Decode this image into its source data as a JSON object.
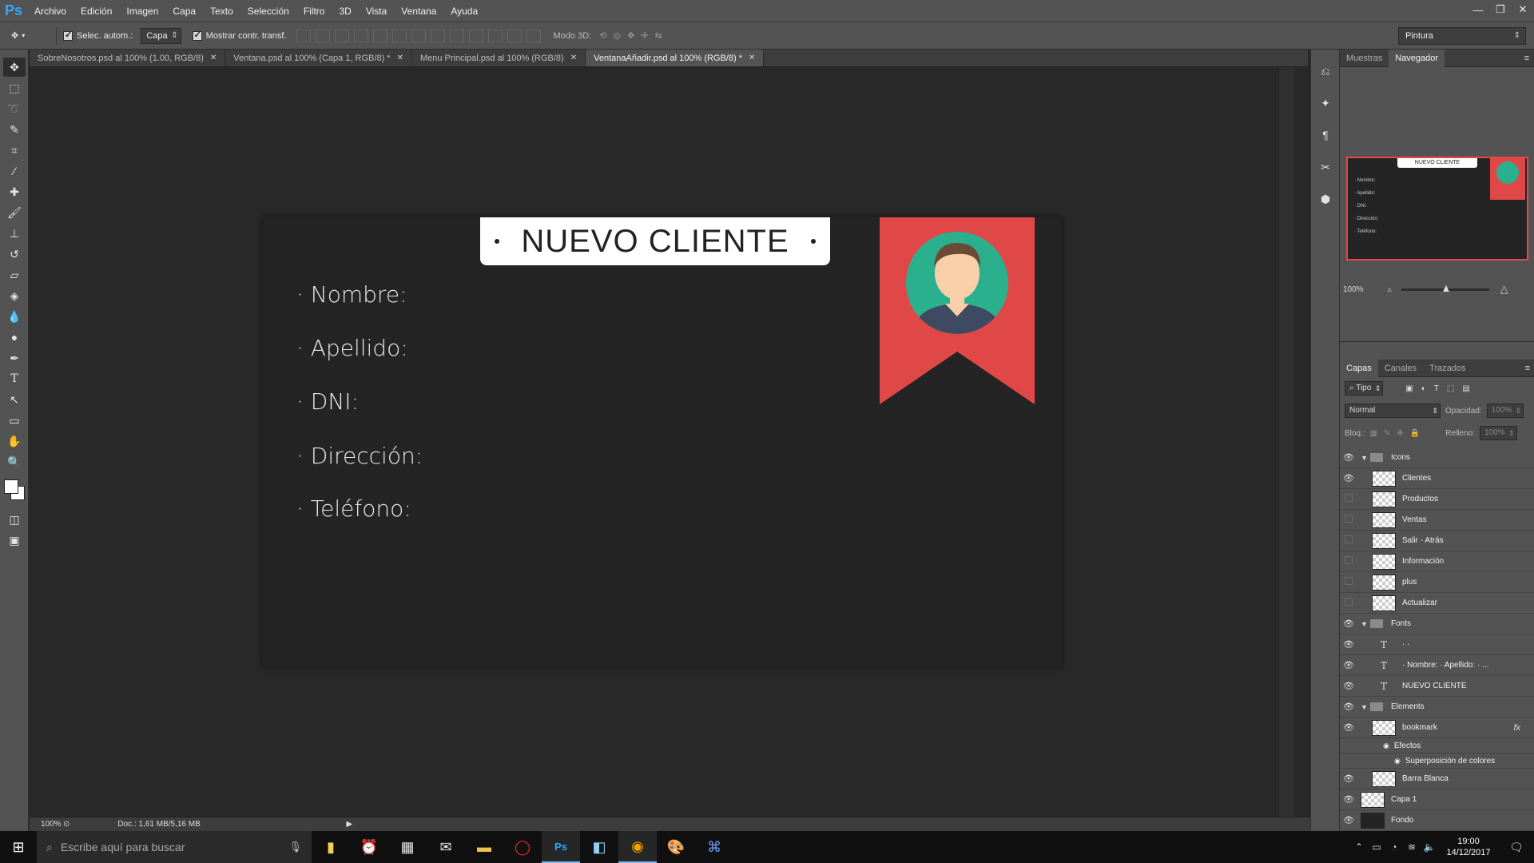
{
  "app": {
    "logo": "Ps",
    "menu": [
      "Archivo",
      "Edición",
      "Imagen",
      "Capa",
      "Texto",
      "Selección",
      "Filtro",
      "3D",
      "Vista",
      "Ventana",
      "Ayuda"
    ]
  },
  "options": {
    "auto_select_label": "Selec. autom.:",
    "auto_select_value": "Capa",
    "show_transform_label": "Mostrar contr. transf.",
    "mode3d_label": "Modo 3D:",
    "workspace": "Pintura"
  },
  "tabs": [
    {
      "label": "SobreNosotros.psd al 100% (1.00, RGB/8)",
      "active": false
    },
    {
      "label": "Ventana.psd al 100% (Capa 1, RGB/8) *",
      "active": false
    },
    {
      "label": "Menu Principal.psd al 100% (RGB/8)",
      "active": false
    },
    {
      "label": "VentanaAñadir.psd al 100% (RGB/8) *",
      "active": true
    }
  ],
  "canvas": {
    "title": "NUEVO CLIENTE",
    "fields": [
      "· Nombre:",
      "· Apellido:",
      "· DNI:",
      "· Dirección:",
      "· Teléfono:"
    ],
    "colors": {
      "bookmark": "#e04848",
      "avatar_bg": "#2bb08d",
      "skin": "#f8cfa7",
      "hair": "#6b4a36",
      "shirt": "#3e4a62"
    }
  },
  "status": {
    "zoom": "100%",
    "doc": "Doc.: 1,61 MB/5,16 MB"
  },
  "navigator": {
    "tabs": [
      "Muestras",
      "Navegador"
    ],
    "active_tab": "Navegador",
    "zoom": "100%"
  },
  "layers_panel": {
    "tabs": [
      "Capas",
      "Canales",
      "Trazados"
    ],
    "filter": "Tipo",
    "blend_mode": "Normal",
    "opacity_label": "Opacidad:",
    "opacity_value": "100%",
    "lock_label": "Bloq.:",
    "fill_label": "Relleno:",
    "fill_value": "100%",
    "layers": [
      {
        "name": "Icons",
        "kind": "group",
        "visible": true,
        "depth": 0
      },
      {
        "name": "Clientes",
        "kind": "smart",
        "visible": true,
        "depth": 1
      },
      {
        "name": "Productos",
        "kind": "smart",
        "visible": false,
        "depth": 1
      },
      {
        "name": "Ventas",
        "kind": "smart",
        "visible": false,
        "depth": 1
      },
      {
        "name": "Salir - Atrás",
        "kind": "smart",
        "visible": false,
        "depth": 1
      },
      {
        "name": "Información",
        "kind": "smart",
        "visible": false,
        "depth": 1
      },
      {
        "name": "plus",
        "kind": "smart",
        "visible": false,
        "depth": 1
      },
      {
        "name": "Actualizar",
        "kind": "smart",
        "visible": false,
        "depth": 1
      },
      {
        "name": "Fonts",
        "kind": "group",
        "visible": true,
        "depth": 0
      },
      {
        "name": "·                ·",
        "kind": "text",
        "visible": true,
        "depth": 1
      },
      {
        "name": "· Nombre:  · Apellido:  · ...",
        "kind": "text",
        "visible": true,
        "depth": 1
      },
      {
        "name": "NUEVO CLIENTE",
        "kind": "text",
        "visible": true,
        "depth": 1
      },
      {
        "name": "Elements",
        "kind": "group",
        "visible": true,
        "depth": 0
      },
      {
        "name": "bookmark",
        "kind": "raster",
        "visible": true,
        "depth": 1,
        "fx": "fx"
      },
      {
        "name": "Efectos",
        "kind": "effect",
        "visible": true,
        "depth": 2
      },
      {
        "name": "Superposición de colores",
        "kind": "effect",
        "visible": true,
        "depth": 3
      },
      {
        "name": "Barra Blanca",
        "kind": "raster",
        "visible": true,
        "depth": 1
      },
      {
        "name": "Capa 1",
        "kind": "raster",
        "visible": true,
        "depth": 0
      },
      {
        "name": "Fondo",
        "kind": "dark",
        "visible": true,
        "depth": 0
      }
    ]
  },
  "taskbar": {
    "search_placeholder": "Escribe aquí para buscar",
    "time": "19:00",
    "date": "14/12/2017"
  }
}
